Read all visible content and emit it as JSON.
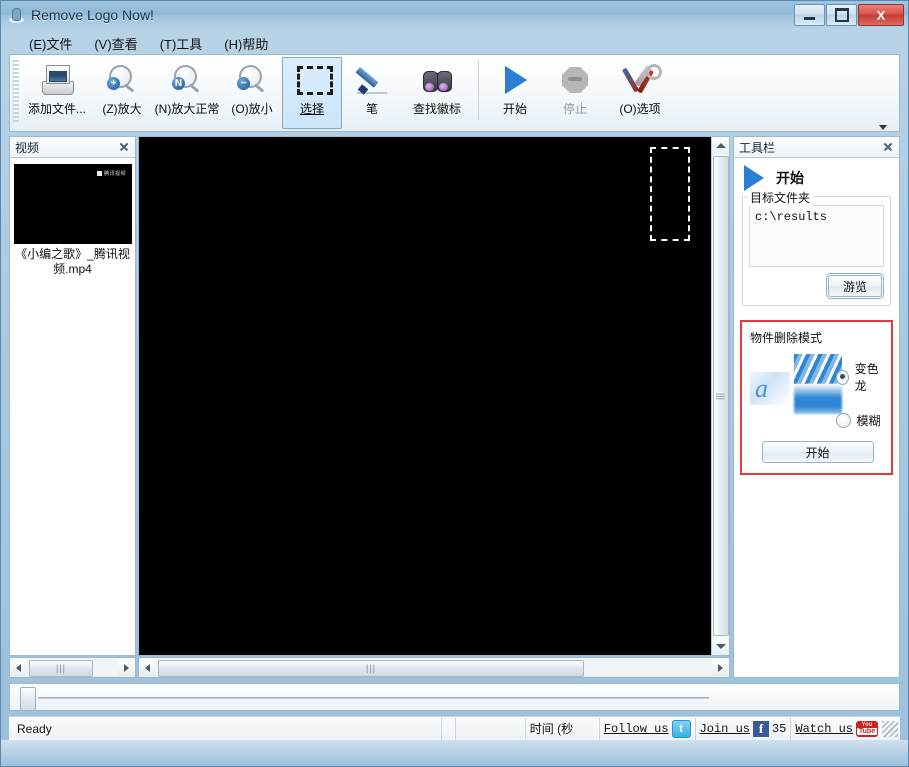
{
  "window": {
    "title": "Remove Logo Now!",
    "icon": "app-logo-icon",
    "buttons": {
      "minimize": "",
      "maximize": "",
      "close": "X"
    }
  },
  "menubar": {
    "items": [
      {
        "name": "file",
        "text": "(E)文件"
      },
      {
        "name": "view",
        "text": "(V)查看"
      },
      {
        "name": "tools",
        "text": "(T)工具"
      },
      {
        "name": "help",
        "text": "(H)帮助"
      }
    ]
  },
  "toolbar": {
    "buttons": [
      {
        "name": "add-file",
        "label": "添加文件...",
        "icon": "add-file-icon",
        "state": "normal"
      },
      {
        "name": "zoom-in",
        "label": "(Z)放大",
        "icon": "magnifier-plus-icon",
        "badge": "+",
        "state": "normal"
      },
      {
        "name": "zoom-normal",
        "label": "(N)放大正常",
        "icon": "magnifier-normal-icon",
        "badge": "N",
        "state": "normal"
      },
      {
        "name": "zoom-out",
        "label": "(O)放小",
        "icon": "magnifier-minus-icon",
        "badge": "−",
        "state": "normal"
      },
      {
        "name": "select",
        "label": "选择",
        "icon": "selection-marquee-icon",
        "state": "active"
      },
      {
        "name": "pen",
        "label": "笔",
        "icon": "pen-icon",
        "state": "normal"
      },
      {
        "name": "find-logo",
        "label": "查找徽标",
        "icon": "binoculars-icon",
        "state": "normal"
      },
      {
        "name": "start",
        "label": "开始",
        "icon": "play-icon",
        "state": "normal"
      },
      {
        "name": "stop",
        "label": "停止",
        "icon": "stop-octagon-icon",
        "state": "disabled"
      },
      {
        "name": "options",
        "label": "(O)选项",
        "icon": "tools-wrench-screwdriver-icon",
        "state": "normal"
      }
    ],
    "overflow": "chevron-down-icon"
  },
  "left_panel": {
    "title": "视频",
    "close": "close-icon",
    "items": [
      {
        "caption": "《小编之歌》_腾讯视频.mp4",
        "thumb_watermark": "腾讯视频"
      }
    ],
    "hscroll": {
      "grip": "|||"
    }
  },
  "video_panel": {
    "selection_rect": "dashed-selection-rectangle",
    "vscroll": {
      "grip": "|||"
    },
    "hscroll": {
      "grip": "|||"
    }
  },
  "right_panel": {
    "title": "工具栏",
    "close": "close-icon",
    "start": {
      "label": "开始",
      "icon": "play-icon"
    },
    "target_folder": {
      "legend": "目标文件夹",
      "path": "c:\\results",
      "browse_button": "游览"
    },
    "mode_panel": {
      "title": "物件删除模式",
      "border_color": "#e03a3a",
      "samples": [
        "sample-a-logo",
        "sample-b-chameleon",
        "sample-c-blur"
      ],
      "options": [
        {
          "name": "chameleon",
          "label": "变色龙",
          "checked": true
        },
        {
          "name": "blur",
          "label": "模糊",
          "checked": false
        }
      ],
      "start_button": "开始"
    }
  },
  "slider": {
    "name": "timeline-slider",
    "value": 0
  },
  "statusbar": {
    "ready": "Ready",
    "cells": {
      "small": "",
      "medium": ""
    },
    "time_label": "时间 (秒",
    "social": {
      "follow": {
        "text": "Follow us",
        "icon": "twitter-icon",
        "icon_glyph": "t"
      },
      "join": {
        "text": "Join us",
        "icon": "facebook-icon",
        "icon_glyph": "f",
        "count": "35"
      },
      "watch": {
        "text": "Watch us",
        "icon": "youtube-icon",
        "icon_top": "You",
        "icon_bottom": "Tube"
      }
    },
    "grip": "resize-grip"
  }
}
